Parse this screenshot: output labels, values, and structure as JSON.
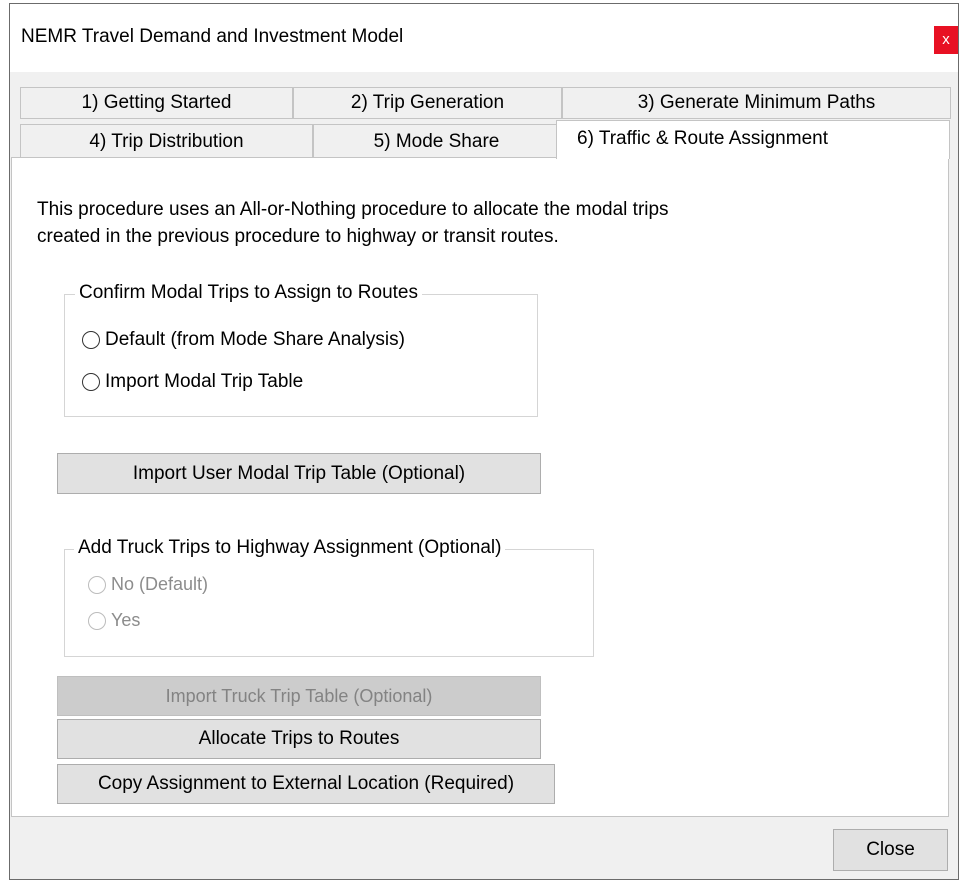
{
  "window": {
    "title": "NEMR Travel Demand and Investment Model",
    "close_glyph": "x"
  },
  "tabs": [
    {
      "label": "1) Getting Started",
      "active": false
    },
    {
      "label": "2) Trip Generation",
      "active": false
    },
    {
      "label": "3) Generate Minimum Paths",
      "active": false
    },
    {
      "label": "4) Trip Distribution",
      "active": false
    },
    {
      "label": "5) Mode Share",
      "active": false
    },
    {
      "label": "6) Traffic & Route Assignment",
      "active": true
    }
  ],
  "panel": {
    "description_line1": "This procedure uses an All-or-Nothing procedure to allocate the modal trips",
    "description_line2": "created in the previous procedure to highway or transit routes.",
    "modal_group": {
      "label": "Confirm Modal Trips to Assign to Routes",
      "options": [
        {
          "label": "Default (from Mode Share Analysis)",
          "selected": false
        },
        {
          "label": "Import Modal Trip Table",
          "selected": false
        }
      ]
    },
    "import_user_modal_button": "Import User Modal Trip Table (Optional)",
    "truck_group": {
      "label": "Add Truck Trips to Highway Assignment (Optional)",
      "options": [
        {
          "label": "No (Default)",
          "selected": false,
          "enabled": false
        },
        {
          "label": "Yes",
          "selected": false,
          "enabled": false
        }
      ]
    },
    "import_truck_button": "Import Truck Trip Table (Optional)",
    "allocate_button": "Allocate Trips to Routes",
    "copy_button": "Copy Assignment to External Location (Required)"
  },
  "footer": {
    "close_button": "Close"
  },
  "colors": {
    "close_accent": "#e81123",
    "dialog_bg": "#f0f0f0",
    "panel_bg": "#ffffff",
    "disabled_text": "#838383"
  }
}
